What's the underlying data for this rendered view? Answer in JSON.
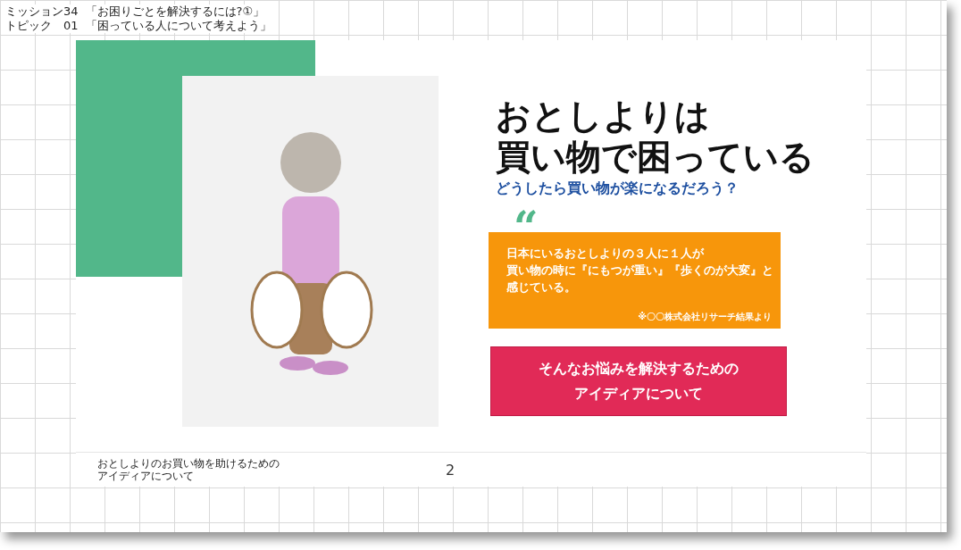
{
  "header": [
    {
      "label": "ミッション34",
      "title": "「お困りごとを解決するには?①」"
    },
    {
      "label": "トピック　01",
      "title": "「困っている人について考えよう」"
    }
  ],
  "slide": {
    "title_lines": [
      "おとしよりは",
      "買い物で困っている"
    ],
    "subtitle": "どうしたら買い物が楽になるだろう？",
    "quote_mark": "“",
    "quote_lines": [
      "日本にいるおとしよりの３人に１人が",
      "買い物の時に『にもつが重い』『歩くのが大変』と",
      "感じている。"
    ],
    "quote_source": "※〇〇株式会社リサーチ結果より",
    "button_lines": [
      "そんなお悩みを解決するための",
      "アイディアについて"
    ],
    "footer_lines": [
      "おとしよりのお買い物を助けるための",
      "アイディアについて"
    ],
    "page_number": "2"
  }
}
